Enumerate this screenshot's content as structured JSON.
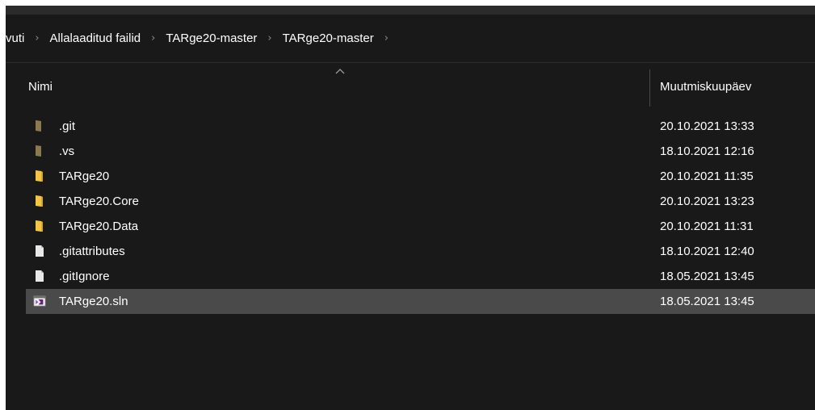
{
  "breadcrumb": {
    "items": [
      "vuti",
      "Allalaaditud failid",
      "TARge20-master",
      "TARge20-master"
    ]
  },
  "columns": {
    "name": "Nimi",
    "modified": "Muutmiskuupäev",
    "sort_direction": "ascending"
  },
  "files": [
    {
      "name": ".git",
      "modified": "20.10.2021 13:33",
      "icon": "hidden-folder-icon"
    },
    {
      "name": ".vs",
      "modified": "18.10.2021 12:16",
      "icon": "hidden-folder-icon"
    },
    {
      "name": "TARge20",
      "modified": "20.10.2021 11:35",
      "icon": "folder-icon"
    },
    {
      "name": "TARge20.Core",
      "modified": "20.10.2021 13:23",
      "icon": "folder-icon"
    },
    {
      "name": "TARge20.Data",
      "modified": "20.10.2021 11:31",
      "icon": "folder-icon"
    },
    {
      "name": ".gitattributes",
      "modified": "18.10.2021 12:40",
      "icon": "file-icon"
    },
    {
      "name": ".gitIgnore",
      "modified": "18.05.2021 13:45",
      "icon": "file-icon"
    },
    {
      "name": "TARge20.sln",
      "modified": "18.05.2021 13:45",
      "icon": "visual-studio-solution-icon",
      "selected": true
    }
  ],
  "colors": {
    "background": "#191919",
    "selected_row": "#4a4a4a",
    "folder": "#f4c542",
    "hidden_folder": "#8b7a4d"
  }
}
